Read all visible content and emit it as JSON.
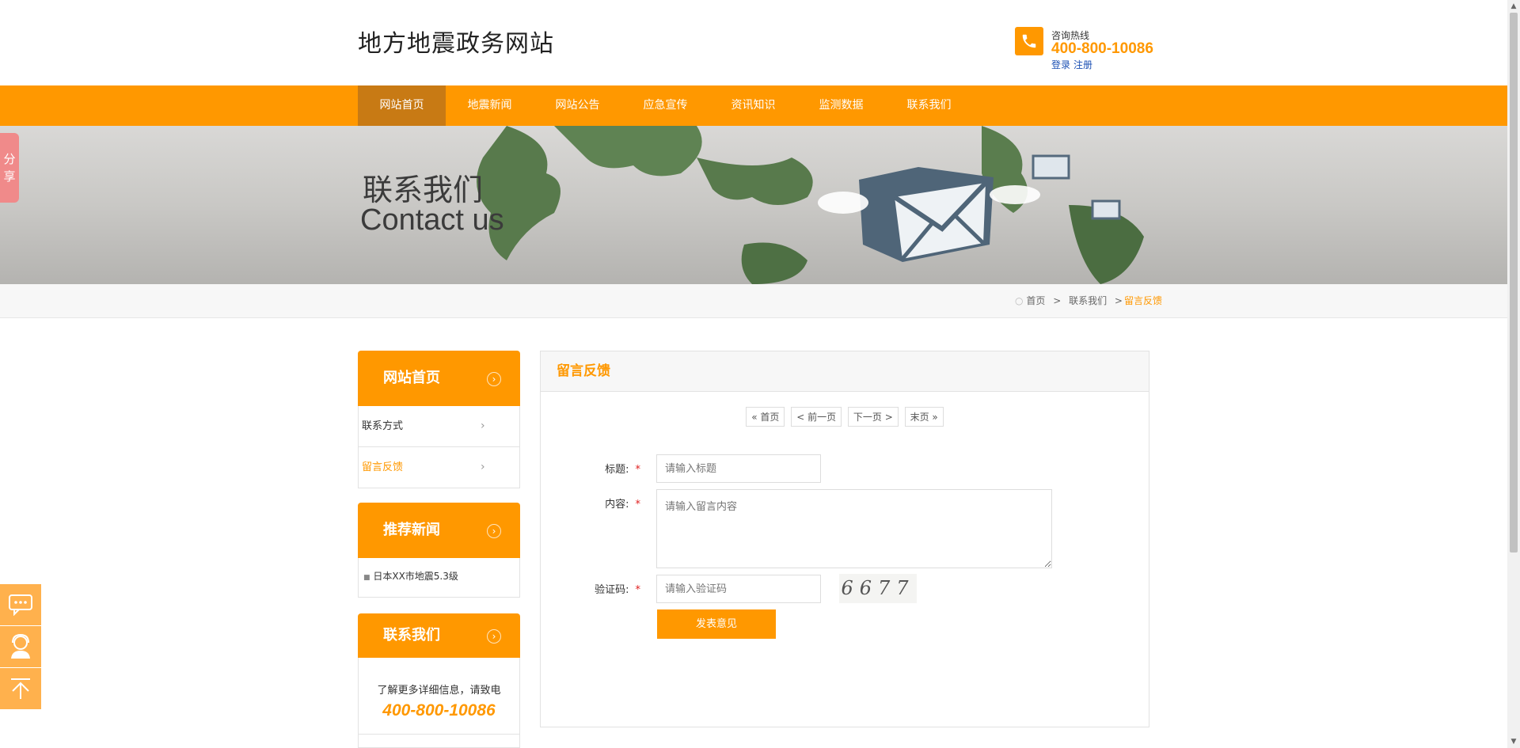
{
  "header": {
    "site_title": "地方地震政务网站",
    "hotline_label": "咨询热线",
    "hotline_number": "400-800-10086",
    "login": "登录",
    "register": "注册"
  },
  "nav": {
    "items": [
      {
        "label": "网站首页",
        "active": true
      },
      {
        "label": "地震新闻"
      },
      {
        "label": "网站公告"
      },
      {
        "label": "应急宣传"
      },
      {
        "label": "资讯知识"
      },
      {
        "label": "监测数据"
      },
      {
        "label": "联系我们"
      }
    ]
  },
  "banner": {
    "title_cn": "联系我们",
    "title_en": "Contact us"
  },
  "share_tab": "分享",
  "breadcrumb": {
    "home": "首页",
    "section": "联系我们",
    "current": "留言反馈",
    "separator": ">"
  },
  "sidebar": {
    "nav_title": "网站首页",
    "links": [
      {
        "label": "联系方式"
      },
      {
        "label": "留言反馈",
        "active": true
      }
    ],
    "news_title": "推荐新闻",
    "news": [
      {
        "title": "日本XX市地震5.3级"
      }
    ],
    "contact_title": "联系我们",
    "contact_text": "了解更多详细信息，请致电",
    "contact_number": "400-800-10086"
  },
  "main": {
    "title": "留言反馈",
    "pager": {
      "first": "« 首页",
      "prev": "< 前一页",
      "next": "下一页 >",
      "last": "末页 »"
    },
    "form": {
      "title_label": "标题:",
      "title_placeholder": "请输入标题",
      "content_label": "内容:",
      "content_placeholder": "请输入留言内容",
      "captcha_label": "验证码:",
      "captcha_placeholder": "请输入验证码",
      "captcha_text": "6677",
      "submit": "发表意见"
    }
  },
  "colors": {
    "accent": "#ff9800",
    "nav_active": "#c87a14",
    "link": "#1a4fb3"
  },
  "float_tools": [
    "chat-icon",
    "customer-service-icon",
    "back-to-top-icon"
  ]
}
